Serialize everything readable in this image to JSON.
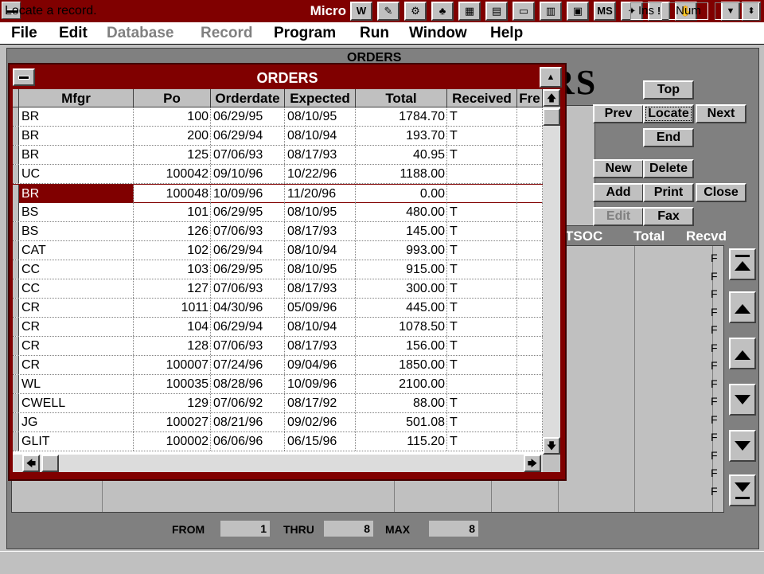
{
  "app": {
    "title": "Micro",
    "toolbar": [
      "W",
      "✎",
      "⚙",
      "♣",
      "▦",
      "▤",
      "▭",
      "▥",
      "▣",
      "MS",
      "✦",
      "!",
      "✋"
    ]
  },
  "menu": [
    {
      "label": "File",
      "enabled": true
    },
    {
      "label": "Edit",
      "enabled": true
    },
    {
      "label": "Database",
      "enabled": false
    },
    {
      "label": "Record",
      "enabled": false
    },
    {
      "label": "Program",
      "enabled": true
    },
    {
      "label": "Run",
      "enabled": true
    },
    {
      "label": "Window",
      "enabled": true
    },
    {
      "label": "Help",
      "enabled": true
    }
  ],
  "back_form": {
    "title": "ORDERS",
    "big_title_fragment": "RS",
    "buttons": {
      "top": "Top",
      "prev": "Prev",
      "locate": "Locate",
      "next": "Next",
      "end": "End",
      "new": "New",
      "delete": "Delete",
      "add": "Add",
      "print": "Print",
      "close": "Close",
      "edit": "Edit",
      "fax": "Fax"
    },
    "columns": [
      "TSOC",
      "Total",
      "Recvd"
    ],
    "flag_char": "F",
    "range": {
      "from_label": "FROM",
      "from": "1",
      "thru_label": "THRU",
      "thru": "8",
      "max_label": "MAX",
      "max": "8"
    }
  },
  "browse": {
    "title": "ORDERS",
    "columns": [
      "Mfgr",
      "Po",
      "Orderdate",
      "Expected",
      "Total",
      "Received",
      "Fre"
    ],
    "current_row": 4,
    "rows": [
      [
        "BR",
        "100",
        "06/29/95",
        "08/10/95",
        "1784.70",
        "T"
      ],
      [
        "BR",
        "200",
        "06/29/94",
        "08/10/94",
        "193.70",
        "T"
      ],
      [
        "BR",
        "125",
        "07/06/93",
        "08/17/93",
        "40.95",
        "T"
      ],
      [
        "UC",
        "100042",
        "09/10/96",
        "10/22/96",
        "1188.00",
        ""
      ],
      [
        "BR",
        "100048",
        "10/09/96",
        "11/20/96",
        "0.00",
        ""
      ],
      [
        "BS",
        "101",
        "06/29/95",
        "08/10/95",
        "480.00",
        "T"
      ],
      [
        "BS",
        "126",
        "07/06/93",
        "08/17/93",
        "145.00",
        "T"
      ],
      [
        "CAT",
        "102",
        "06/29/94",
        "08/10/94",
        "993.00",
        "T"
      ],
      [
        "CC",
        "103",
        "06/29/95",
        "08/10/95",
        "915.00",
        "T"
      ],
      [
        "CC",
        "127",
        "07/06/93",
        "08/17/93",
        "300.00",
        "T"
      ],
      [
        "CR",
        "1011",
        "04/30/96",
        "05/09/96",
        "445.00",
        "T"
      ],
      [
        "CR",
        "104",
        "06/29/94",
        "08/10/94",
        "1078.50",
        "T"
      ],
      [
        "CR",
        "128",
        "07/06/93",
        "08/17/93",
        "156.00",
        "T"
      ],
      [
        "CR",
        "100007",
        "07/24/96",
        "09/04/96",
        "1850.00",
        "T"
      ],
      [
        "WL",
        "100035",
        "08/28/96",
        "10/09/96",
        "2100.00",
        ""
      ],
      [
        "CWELL",
        "129",
        "07/06/92",
        "08/17/92",
        "88.00",
        "T"
      ],
      [
        "JG",
        "100027",
        "08/21/96",
        "09/02/96",
        "501.08",
        "T"
      ],
      [
        "GLIT",
        "100002",
        "06/06/96",
        "06/15/96",
        "115.20",
        "T"
      ]
    ]
  },
  "status": {
    "message": "Locate a record.",
    "ins": "Ins",
    "num": "Num"
  },
  "colors": {
    "title_bar": "#800000",
    "face": "#c0c0c0",
    "dark": "#808080"
  }
}
